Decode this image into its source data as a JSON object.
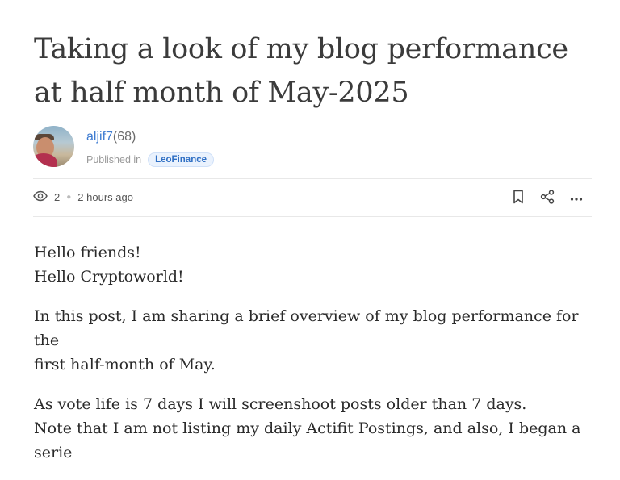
{
  "post": {
    "title": "Taking a look of my blog performance at half month of May-2025",
    "author": {
      "name": "aljif7",
      "reputation": "(68)"
    },
    "published_label": "Published in",
    "community": "LeoFinance",
    "views": "2",
    "time_ago": "2 hours ago",
    "icons": {
      "views": "eye-icon",
      "bookmark": "bookmark-icon",
      "share": "share-icon",
      "more": "more-icon"
    },
    "paragraphs": [
      {
        "lines": [
          "Hello friends!",
          "Hello Cryptoworld!"
        ]
      },
      {
        "lines": [
          "In this post, I am sharing a brief overview of my blog performance for the",
          "first half-month of May."
        ]
      },
      {
        "lines": [
          "As vote life is 7 days I will screenshoot posts older than 7 days.",
          "Note that I am not listing my daily Actifit Postings, and also, I began a serie"
        ]
      }
    ]
  }
}
